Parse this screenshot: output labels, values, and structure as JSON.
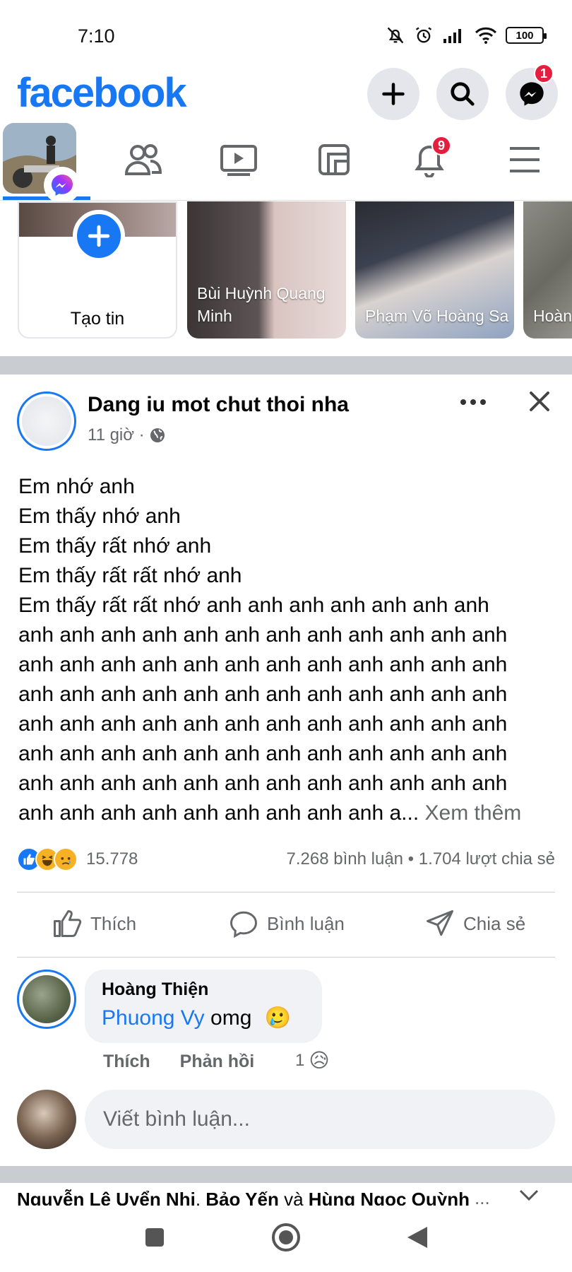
{
  "status_bar": {
    "time": "7:10",
    "battery": "100",
    "icons": [
      "mute-icon",
      "alarm-icon",
      "signal-icon",
      "wifi-icon",
      "battery-icon"
    ]
  },
  "header": {
    "logo": "facebook",
    "buttons": [
      "plus-icon",
      "search-icon",
      "messenger-icon"
    ],
    "messenger_badge": "1"
  },
  "tabs": {
    "items": [
      "profile",
      "friends-icon",
      "watch-icon",
      "gaming-icon",
      "notifications-icon",
      "menu-icon"
    ],
    "notifications_badge": "9"
  },
  "stories": {
    "create_label": "Tạo tin",
    "items": [
      {
        "name": "Bùi Huỳnh Quang Minh"
      },
      {
        "name": "Phạm Võ Hoàng Sa"
      },
      {
        "name": "Hoàn"
      }
    ]
  },
  "post": {
    "page_name": "Dang iu mot chut thoi nha",
    "time": "11 giờ ·",
    "lines": [
      "Em nhớ anh",
      "Em thấy nhớ anh",
      "Em thấy rất nhớ anh",
      "Em thấy rất rất nhớ anh",
      "Em thấy rất rất nhớ anh anh anh anh anh anh anh",
      "anh anh anh anh anh anh anh anh anh anh anh anh",
      "anh anh anh anh anh anh anh anh anh anh anh anh",
      "anh anh anh anh anh anh anh anh anh anh anh anh",
      "anh anh anh anh anh anh anh anh anh anh anh anh",
      "anh anh anh anh anh anh anh anh anh anh anh anh",
      "anh anh anh anh anh anh anh anh anh anh anh anh"
    ],
    "last_line": "anh anh anh anh anh anh anh anh anh a...",
    "see_more": "Xem thêm",
    "reaction_count": "15.778",
    "comments_shares": "7.268 bình luận • 1.704 lượt chia sẻ",
    "actions": {
      "like": "Thích",
      "comment": "Bình luận",
      "share": "Chia sẻ"
    }
  },
  "comment": {
    "author": "Hoàng Thiện",
    "mention": "Phuong Vy",
    "text": "omg",
    "emoji": "🥲",
    "like": "Thích",
    "reply": "Phản hồi",
    "reaction_count": "1",
    "reaction_emoji": "😥"
  },
  "composer": {
    "placeholder": "Viết bình luận..."
  },
  "next_post": {
    "name1": "Nguyễn Lê Uyển Nhi",
    "sep1": ", ",
    "name2": "Bảo Yến",
    "and": " và ",
    "name3": "Hùng Ngọc Quỳnh",
    "more": "..."
  },
  "colors": {
    "brand": "#1877f2",
    "badge": "#e41e3f",
    "muted": "#65676b"
  }
}
